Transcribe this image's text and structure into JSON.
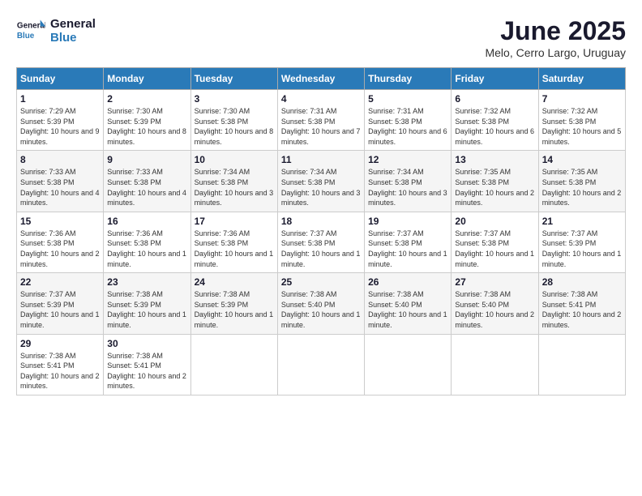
{
  "logo": {
    "line1": "General",
    "line2": "Blue"
  },
  "title": "June 2025",
  "location": "Melo, Cerro Largo, Uruguay",
  "weekdays": [
    "Sunday",
    "Monday",
    "Tuesday",
    "Wednesday",
    "Thursday",
    "Friday",
    "Saturday"
  ],
  "weeks": [
    [
      {
        "day": "1",
        "sunrise": "7:29 AM",
        "sunset": "5:39 PM",
        "daylight": "10 hours and 9 minutes."
      },
      {
        "day": "2",
        "sunrise": "7:30 AM",
        "sunset": "5:39 PM",
        "daylight": "10 hours and 8 minutes."
      },
      {
        "day": "3",
        "sunrise": "7:30 AM",
        "sunset": "5:38 PM",
        "daylight": "10 hours and 8 minutes."
      },
      {
        "day": "4",
        "sunrise": "7:31 AM",
        "sunset": "5:38 PM",
        "daylight": "10 hours and 7 minutes."
      },
      {
        "day": "5",
        "sunrise": "7:31 AM",
        "sunset": "5:38 PM",
        "daylight": "10 hours and 6 minutes."
      },
      {
        "day": "6",
        "sunrise": "7:32 AM",
        "sunset": "5:38 PM",
        "daylight": "10 hours and 6 minutes."
      },
      {
        "day": "7",
        "sunrise": "7:32 AM",
        "sunset": "5:38 PM",
        "daylight": "10 hours and 5 minutes."
      }
    ],
    [
      {
        "day": "8",
        "sunrise": "7:33 AM",
        "sunset": "5:38 PM",
        "daylight": "10 hours and 4 minutes."
      },
      {
        "day": "9",
        "sunrise": "7:33 AM",
        "sunset": "5:38 PM",
        "daylight": "10 hours and 4 minutes."
      },
      {
        "day": "10",
        "sunrise": "7:34 AM",
        "sunset": "5:38 PM",
        "daylight": "10 hours and 3 minutes."
      },
      {
        "day": "11",
        "sunrise": "7:34 AM",
        "sunset": "5:38 PM",
        "daylight": "10 hours and 3 minutes."
      },
      {
        "day": "12",
        "sunrise": "7:34 AM",
        "sunset": "5:38 PM",
        "daylight": "10 hours and 3 minutes."
      },
      {
        "day": "13",
        "sunrise": "7:35 AM",
        "sunset": "5:38 PM",
        "daylight": "10 hours and 2 minutes."
      },
      {
        "day": "14",
        "sunrise": "7:35 AM",
        "sunset": "5:38 PM",
        "daylight": "10 hours and 2 minutes."
      }
    ],
    [
      {
        "day": "15",
        "sunrise": "7:36 AM",
        "sunset": "5:38 PM",
        "daylight": "10 hours and 2 minutes."
      },
      {
        "day": "16",
        "sunrise": "7:36 AM",
        "sunset": "5:38 PM",
        "daylight": "10 hours and 1 minute."
      },
      {
        "day": "17",
        "sunrise": "7:36 AM",
        "sunset": "5:38 PM",
        "daylight": "10 hours and 1 minute."
      },
      {
        "day": "18",
        "sunrise": "7:37 AM",
        "sunset": "5:38 PM",
        "daylight": "10 hours and 1 minute."
      },
      {
        "day": "19",
        "sunrise": "7:37 AM",
        "sunset": "5:38 PM",
        "daylight": "10 hours and 1 minute."
      },
      {
        "day": "20",
        "sunrise": "7:37 AM",
        "sunset": "5:38 PM",
        "daylight": "10 hours and 1 minute."
      },
      {
        "day": "21",
        "sunrise": "7:37 AM",
        "sunset": "5:39 PM",
        "daylight": "10 hours and 1 minute."
      }
    ],
    [
      {
        "day": "22",
        "sunrise": "7:37 AM",
        "sunset": "5:39 PM",
        "daylight": "10 hours and 1 minute."
      },
      {
        "day": "23",
        "sunrise": "7:38 AM",
        "sunset": "5:39 PM",
        "daylight": "10 hours and 1 minute."
      },
      {
        "day": "24",
        "sunrise": "7:38 AM",
        "sunset": "5:39 PM",
        "daylight": "10 hours and 1 minute."
      },
      {
        "day": "25",
        "sunrise": "7:38 AM",
        "sunset": "5:40 PM",
        "daylight": "10 hours and 1 minute."
      },
      {
        "day": "26",
        "sunrise": "7:38 AM",
        "sunset": "5:40 PM",
        "daylight": "10 hours and 1 minute."
      },
      {
        "day": "27",
        "sunrise": "7:38 AM",
        "sunset": "5:40 PM",
        "daylight": "10 hours and 2 minutes."
      },
      {
        "day": "28",
        "sunrise": "7:38 AM",
        "sunset": "5:41 PM",
        "daylight": "10 hours and 2 minutes."
      }
    ],
    [
      {
        "day": "29",
        "sunrise": "7:38 AM",
        "sunset": "5:41 PM",
        "daylight": "10 hours and 2 minutes."
      },
      {
        "day": "30",
        "sunrise": "7:38 AM",
        "sunset": "5:41 PM",
        "daylight": "10 hours and 2 minutes."
      },
      null,
      null,
      null,
      null,
      null
    ]
  ]
}
